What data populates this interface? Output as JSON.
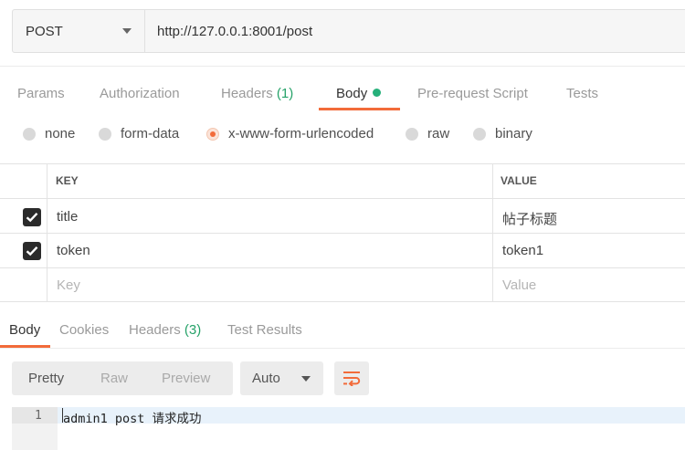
{
  "request": {
    "method": "POST",
    "url": "http://127.0.0.1:8001/post"
  },
  "tabs": {
    "params": "Params",
    "authorization": "Authorization",
    "headers": "Headers",
    "headers_count": "(1)",
    "body": "Body",
    "prerequest": "Pre-request Script",
    "tests": "Tests"
  },
  "body_modes": {
    "none": "none",
    "form_data": "form-data",
    "urlencoded": "x-www-form-urlencoded",
    "raw": "raw",
    "binary": "binary",
    "selected": "x-www-form-urlencoded"
  },
  "params_table": {
    "key_header": "KEY",
    "value_header": "VALUE",
    "rows": [
      {
        "key": "title",
        "value": "帖子标题",
        "checked": true
      },
      {
        "key": "token",
        "value": "token1",
        "checked": true
      }
    ],
    "key_placeholder": "Key",
    "value_placeholder": "Value"
  },
  "response_tabs": {
    "body": "Body",
    "cookies": "Cookies",
    "headers": "Headers",
    "headers_count": "(3)",
    "test_results": "Test Results"
  },
  "response_toolbar": {
    "pretty": "Pretty",
    "raw": "Raw",
    "preview": "Preview",
    "format": "Auto",
    "wrap_icon": "wrap-lines-icon"
  },
  "response_body": {
    "line_number": "1",
    "line_text": "admin1 post 请求成功"
  },
  "colors": {
    "accent": "#f26b3a",
    "count_green": "#26a269",
    "status_dot": "#26b07a"
  }
}
